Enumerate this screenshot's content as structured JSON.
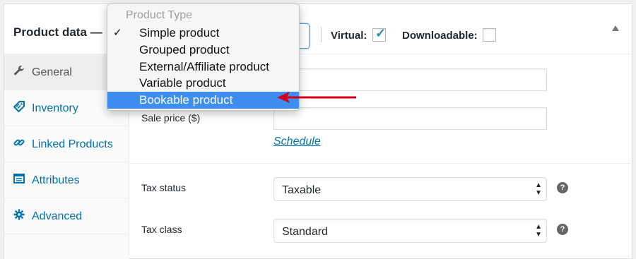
{
  "header": {
    "title": "Product data —",
    "virtual_label": "Virtual:",
    "virtual_checked": true,
    "downloadable_label": "Downloadable:",
    "downloadable_checked": false
  },
  "dropdown": {
    "group_label": "Product Type",
    "options": [
      {
        "label": "Simple product",
        "checked": true
      },
      {
        "label": "Grouped product",
        "checked": false
      },
      {
        "label": "External/Affiliate product",
        "checked": false
      },
      {
        "label": "Variable product",
        "checked": false
      },
      {
        "label": "Bookable product",
        "highlighted": true
      }
    ],
    "check_mark": "✓"
  },
  "tabs": [
    {
      "label": "General",
      "icon": "wrench-icon",
      "active": true
    },
    {
      "label": "Inventory",
      "icon": "tag-icon"
    },
    {
      "label": "Linked Products",
      "icon": "link-icon"
    },
    {
      "label": "Attributes",
      "icon": "list-icon"
    },
    {
      "label": "Advanced",
      "icon": "gear-icon"
    }
  ],
  "general": {
    "regular_price_value": "",
    "sale_price_label": "Sale price ($)",
    "sale_price_value": "",
    "schedule_link": "Schedule",
    "tax_status_label": "Tax status",
    "tax_status_value": "Taxable",
    "tax_class_label": "Tax class",
    "tax_class_value": "Standard",
    "help_glyph": "?"
  },
  "colors": {
    "link": "#0073aa",
    "highlight": "#3d8ef0",
    "annotation_arrow": "#d0021b"
  }
}
